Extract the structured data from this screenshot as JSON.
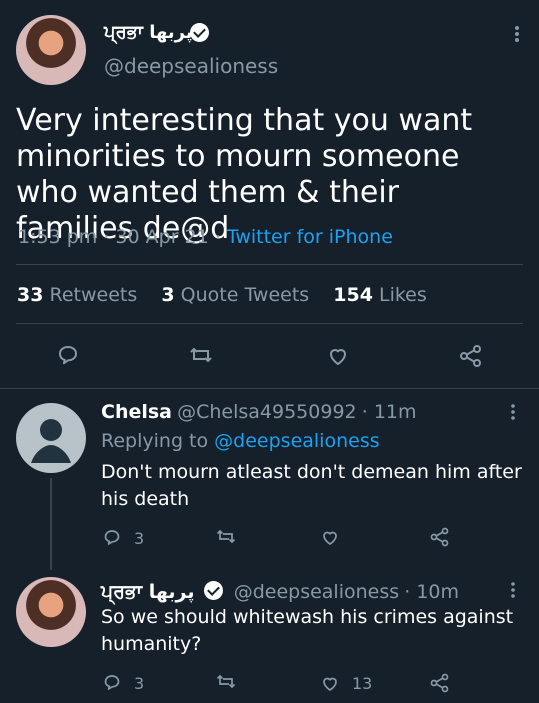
{
  "tweet": {
    "author_name": "ਪ੍ਰਭਾ پربھا",
    "author_handle": "@deepsealioness",
    "text": "Very interesting that you want minorities to mourn someone who wanted them & their families de@d",
    "time": "1:53 pm",
    "date": "30 Apr 21",
    "source": "Twitter for iPhone",
    "stats": {
      "retweets_count": "33",
      "retweets_label": "Retweets",
      "quote_count": "3",
      "quote_label": "Quote Tweets",
      "likes_count": "154",
      "likes_label": "Likes"
    },
    "icons": {
      "reply": "reply-icon",
      "retweet": "retweet-icon",
      "like": "heart-icon",
      "share": "share-icon",
      "more": "more-icon"
    }
  },
  "replies": [
    {
      "author_name": "Chelsa",
      "author_handle": "@Chelsa49550992",
      "time": "11m",
      "replying_to_prefix": "Replying to",
      "replying_to_handle": "@deepsealioness",
      "text_line1": "Don't mourn atleast don't demean him after",
      "text_line2": "his death",
      "reply_count": "3",
      "retweet_count": "",
      "like_count": ""
    },
    {
      "author_name": "ਪ੍ਰਭਾ پربھا",
      "author_handle": "@deepsealioness",
      "time": "10m",
      "text_line1": "So we should whitewash his crimes against",
      "text_line2": "humanity?",
      "reply_count": "3",
      "retweet_count": "",
      "like_count": "13"
    }
  ],
  "colors": {
    "background": "#15202b",
    "text_primary": "#ffffff",
    "text_secondary": "#8899a6",
    "link": "#1da1f2",
    "divider": "#38444d"
  }
}
